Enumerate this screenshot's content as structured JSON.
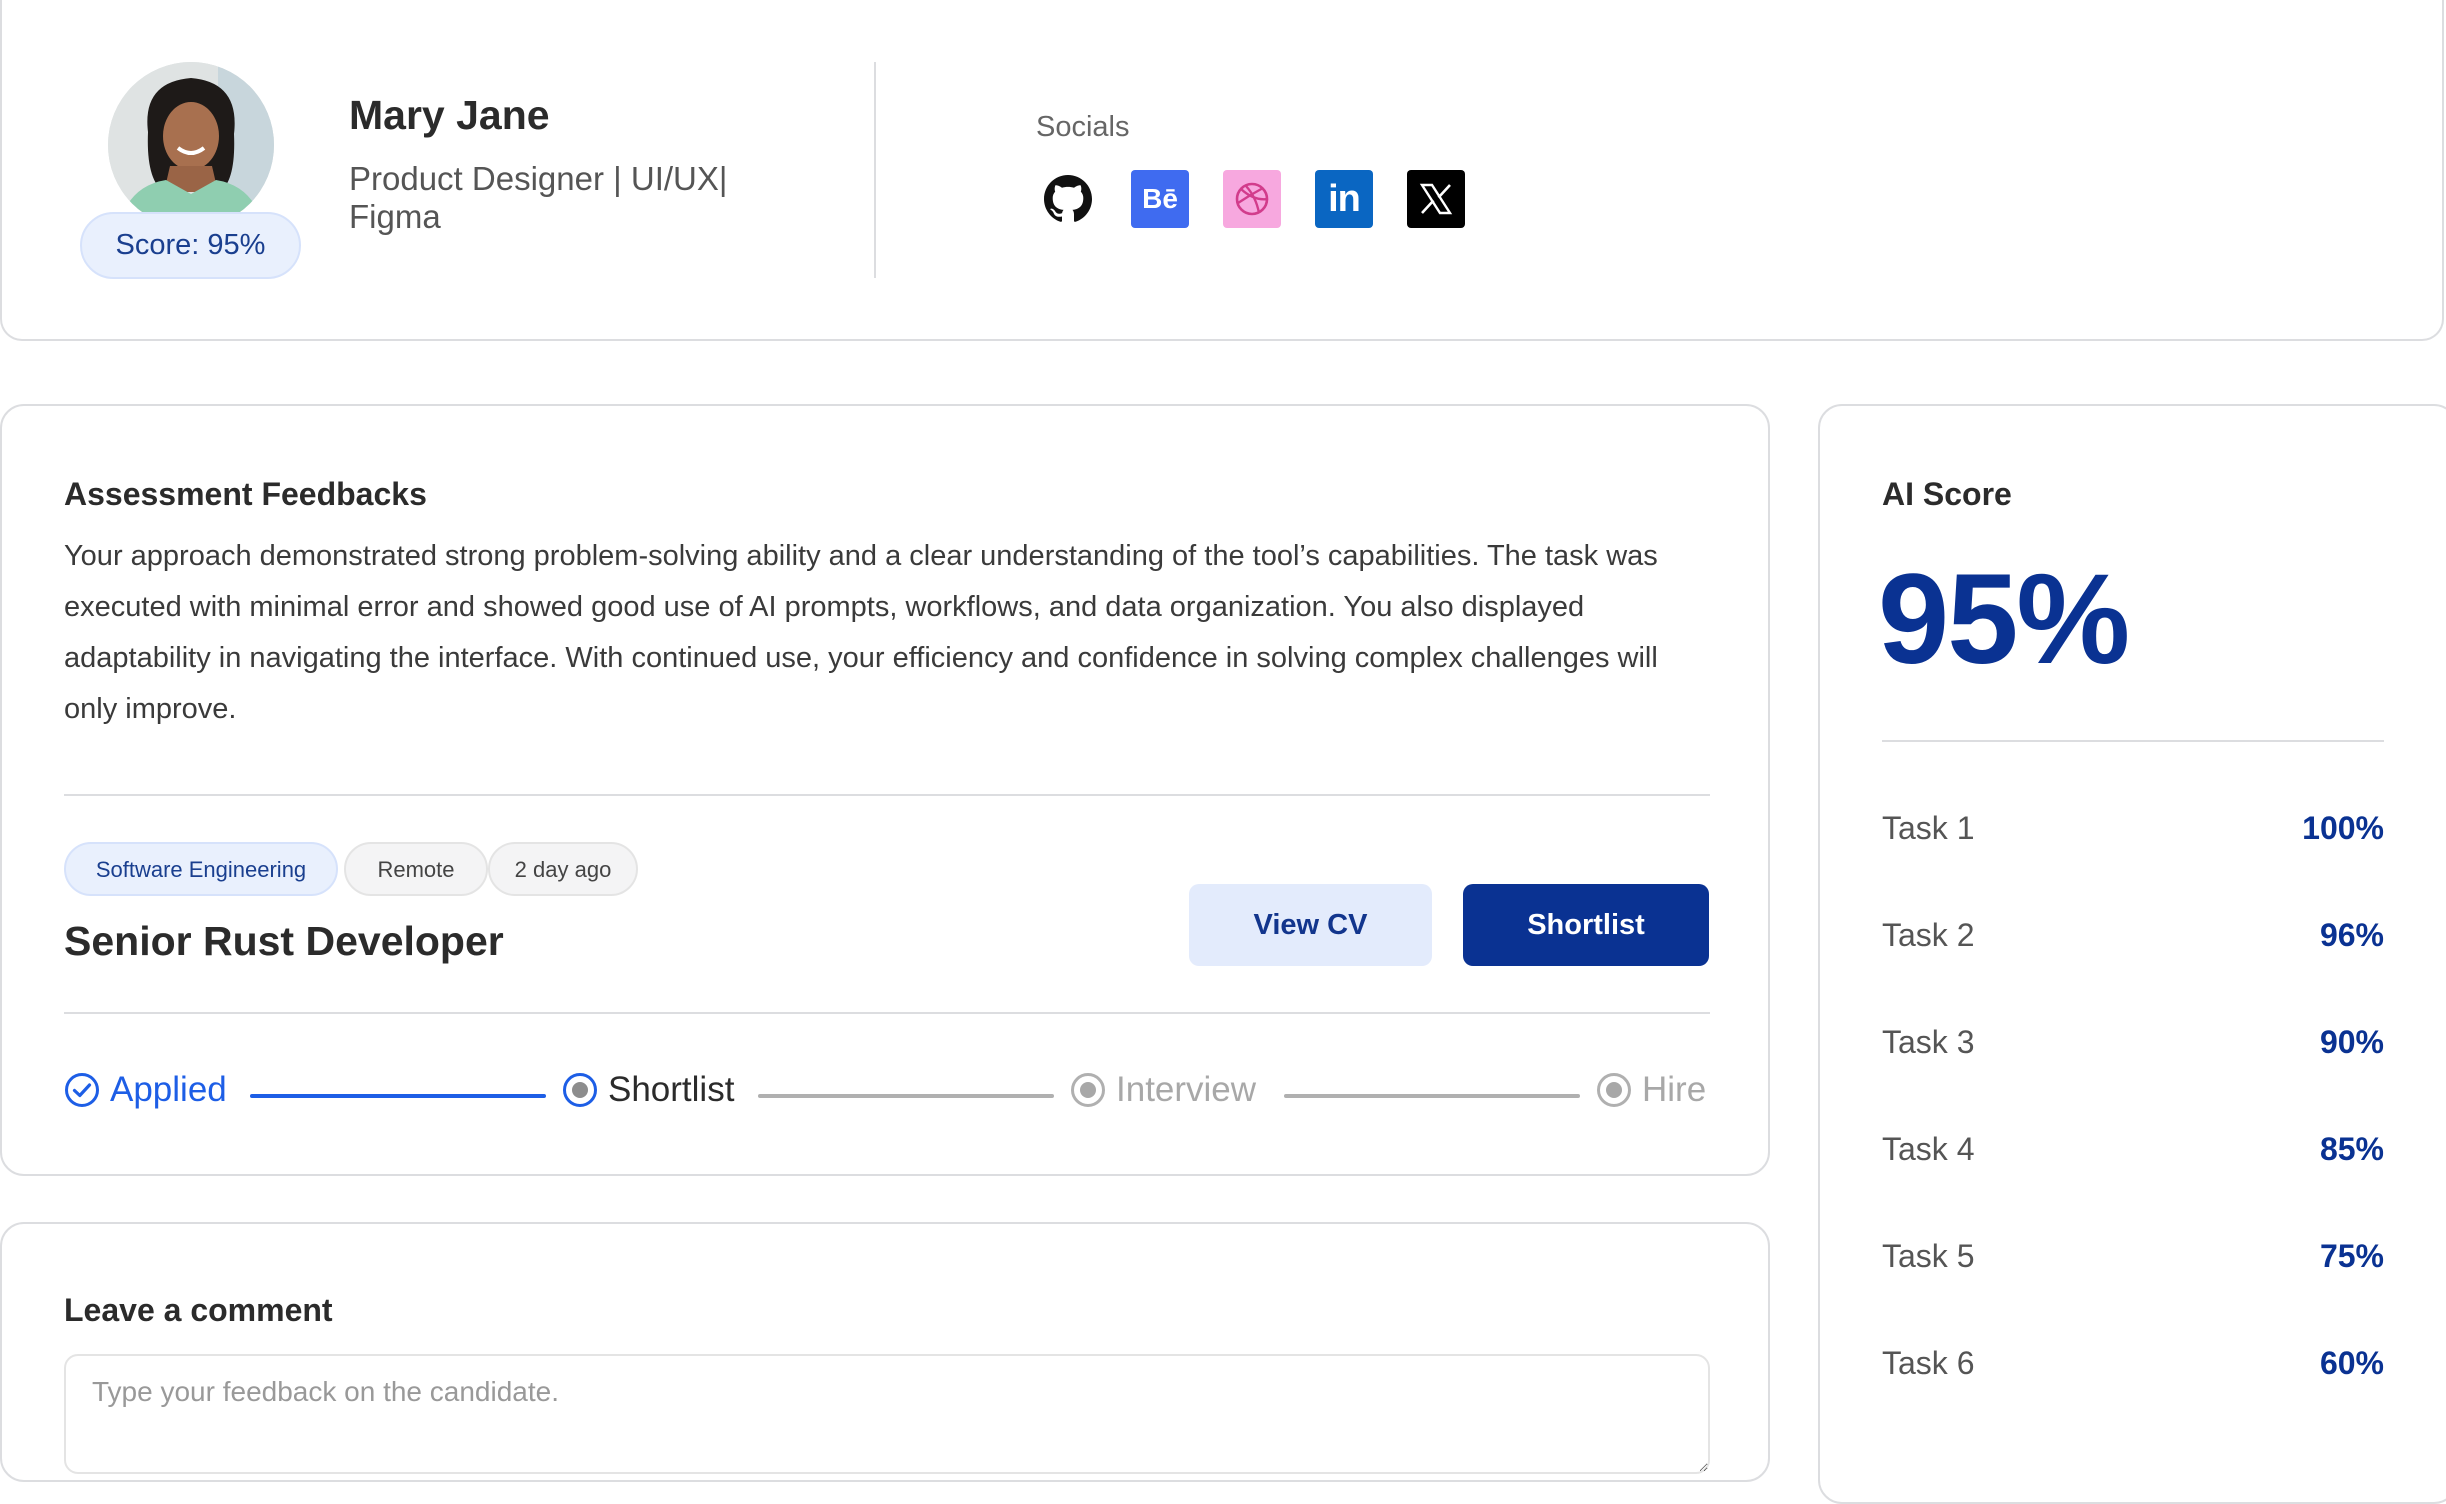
{
  "profile": {
    "name": "Mary Jane",
    "role": "Product Designer | UI/UX| Figma",
    "score_label": "Score: 95%",
    "socials_label": "Socials",
    "socials": [
      "github-icon",
      "behance-icon",
      "dribbble-icon",
      "linkedin-icon",
      "x-icon"
    ]
  },
  "assessment": {
    "title": "Assessment Feedbacks",
    "feedback": "Your approach demonstrated strong problem-solving ability and a clear understanding of the tool’s capabilities. The task was executed with minimal error and showed good use of AI prompts, workflows, and data organization. You also displayed adaptability in navigating the interface. With continued use, your efficiency and confidence in solving complex challenges will only improve.",
    "tags": [
      "Software Engineering",
      "Remote",
      "2 day ago"
    ],
    "job_title": "Senior Rust Developer",
    "view_cv_label": "View CV",
    "shortlist_label": "Shortlist",
    "steps": [
      {
        "label": "Applied",
        "state": "done"
      },
      {
        "label": "Shortlist",
        "state": "current"
      },
      {
        "label": "Interview",
        "state": "pending"
      },
      {
        "label": "Hire",
        "state": "pending"
      }
    ]
  },
  "comment": {
    "title": "Leave a comment",
    "placeholder": "Type your feedback on the candidate."
  },
  "ai_score": {
    "title": "AI Score",
    "value": "95%",
    "tasks": [
      {
        "name": "Task 1",
        "value": "100%"
      },
      {
        "name": "Task 2",
        "value": "96%"
      },
      {
        "name": "Task 3",
        "value": "90%"
      },
      {
        "name": "Task 4",
        "value": "85%"
      },
      {
        "name": "Task 5",
        "value": "75%"
      },
      {
        "name": "Task 6",
        "value": "60%"
      }
    ]
  },
  "colors": {
    "brand_navy": "#0a3292",
    "step_active_blue": "#1d5ee6",
    "pill_bg": "#e9f0fd"
  }
}
